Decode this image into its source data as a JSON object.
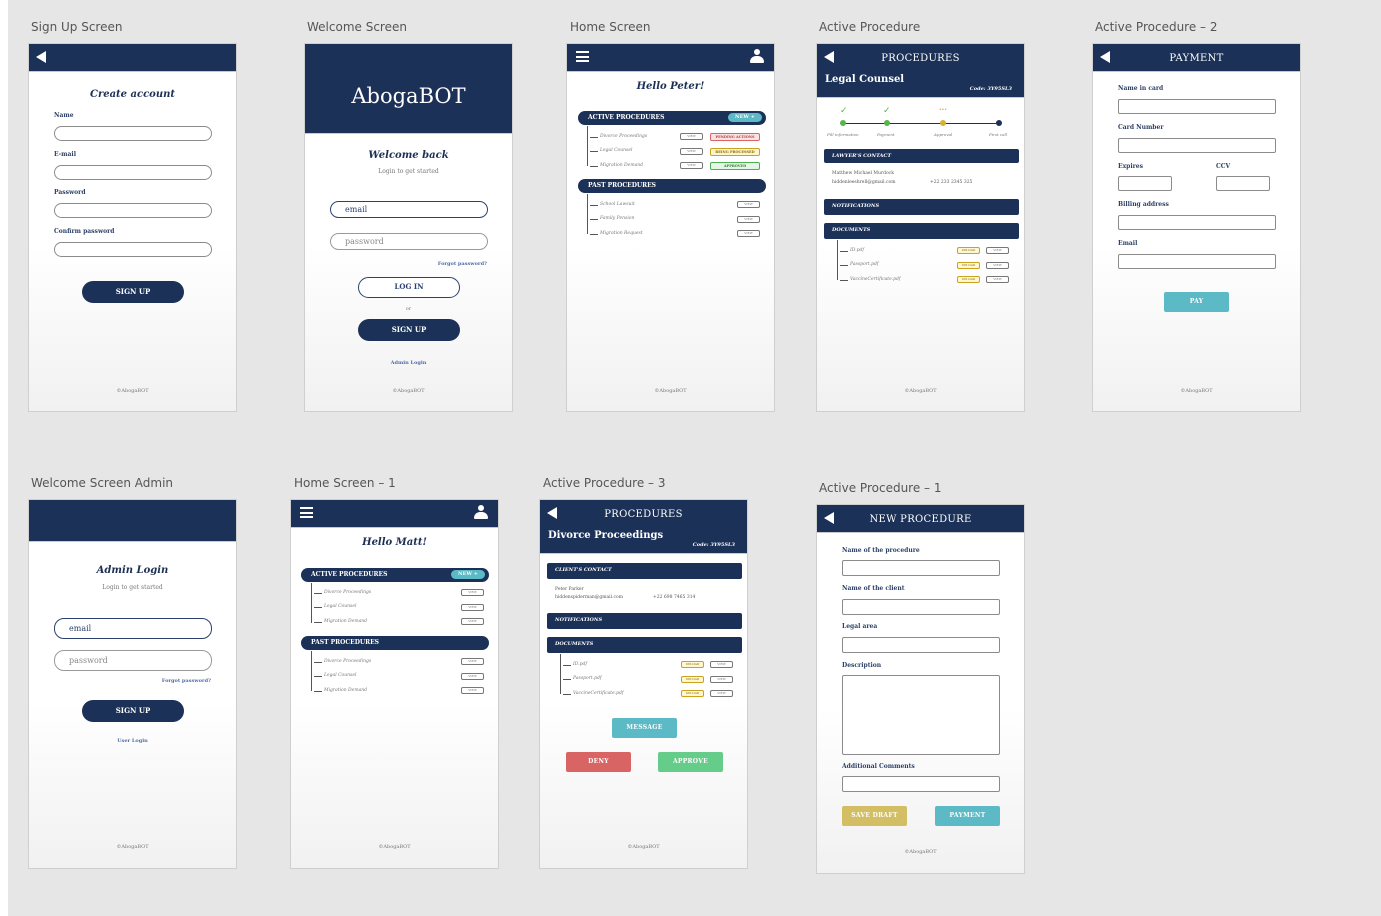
{
  "labels": {
    "signup": "Sign Up Screen",
    "welcome": "Welcome Screen",
    "home": "Home Screen",
    "active": "Active Procedure",
    "active2": "Active Procedure – 2",
    "welcomeAdmin": "Welcome Screen Admin",
    "home1": "Home Screen – 1",
    "active3": "Active Procedure – 3",
    "active1": "Active Procedure – 1"
  },
  "footer": "©AbogaBOT",
  "signup": {
    "title": "Create account",
    "name": "Name",
    "email": "E-mail",
    "password": "Password",
    "confirm": "Confirm password",
    "button": "SIGN UP"
  },
  "welcome": {
    "brand": "AbogaBOT",
    "title": "Welcome back",
    "sub": "Login to get started",
    "email": "email",
    "password": "password",
    "forgot": "Forgot password?",
    "login": "LOG IN",
    "or": "or",
    "signup": "SIGN UP",
    "admin": "Admin Login"
  },
  "home": {
    "greeting": "Hello Peter!",
    "active": "ACTIVE PROCEDURES",
    "new": "NEW +",
    "past": "PAST PROCEDURES",
    "activeItems": [
      "Divorce Proceedings",
      "Legal Counsel",
      "Migration Demand"
    ],
    "status": [
      "PENDING ACTIONS",
      "BEING PROCESSED",
      "APPROVED"
    ],
    "pastItems": [
      "School Lawsuit",
      "Family Pension",
      "Migration Request"
    ],
    "view": "VIEW"
  },
  "active": {
    "header": "PROCEDURES",
    "sub": "Legal Counsel",
    "code": "Code: 3Y95SL3",
    "steps": [
      "Fill information",
      "Payment",
      "Approval",
      "First call"
    ],
    "lawyer": "LAWYER'S CONTACT",
    "lawyerName": "Matthew Michael Murdock",
    "lawyerEmail": "hiddenleeshrell@gmail.com",
    "lawyerPhone": "+22 233 2345 325",
    "notifications": "NOTIFICATIONS",
    "documents": "DOCUMENTS",
    "docs": [
      "ID.pdf",
      "Passport.pdf",
      "VaccineCertificate.pdf"
    ],
    "upload": "UPLOAD",
    "view": "VIEW"
  },
  "payment": {
    "header": "PAYMENT",
    "name": "Name in card",
    "card": "Card Number",
    "expires": "Expires",
    "ccv": "CCV",
    "billing": "Billing address",
    "email": "Email",
    "pay": "PAY"
  },
  "admin": {
    "title": "Admin Login",
    "sub": "Login to get started",
    "email": "email",
    "password": "password",
    "forgot": "Forgot password?",
    "signup": "SIGN UP",
    "user": "User Login"
  },
  "home1": {
    "greeting": "Hello Matt!",
    "active": "ACTIVE PROCEDURES",
    "new": "NEW +",
    "past": "PAST PROCEDURES",
    "activeItems": [
      "Divorce Proceedings",
      "Legal Counsel",
      "Migration Demand"
    ],
    "pastItems": [
      "Divorce Proceedings",
      "Legal Counsel",
      "Migration Demand"
    ],
    "view": "VIEW"
  },
  "active3": {
    "header": "PROCEDURES",
    "sub": "Divorce Proceedings",
    "code": "Code: 3Y95SL3",
    "client": "CLIENT'S CONTACT",
    "clientName": "Peter Parker",
    "clientEmail": "hiddenspiderman@gmail.com",
    "clientPhone": "+22 698 7465 314",
    "notifications": "NOTIFICATIONS",
    "documents": "DOCUMENTS",
    "docs": [
      "ID.pdf",
      "Passport.pdf",
      "VaccineCertificate.pdf"
    ],
    "upload": "UPLOAD",
    "view": "VIEW",
    "message": "MESSAGE",
    "deny": "DENY",
    "approve": "APPROVE"
  },
  "newproc": {
    "header": "NEW PROCEDURE",
    "nameProc": "Name of the procedure",
    "nameClient": "Name of the client",
    "area": "Legal area",
    "desc": "Description",
    "comments": "Additional Comments",
    "draft": "SAVE DRAFT",
    "payment": "PAYMENT"
  },
  "colors": {
    "navy": "#1c3158",
    "teal": "#5bbac6",
    "red": "#d86464",
    "green": "#66cc8a",
    "gold": "#d3be63"
  }
}
